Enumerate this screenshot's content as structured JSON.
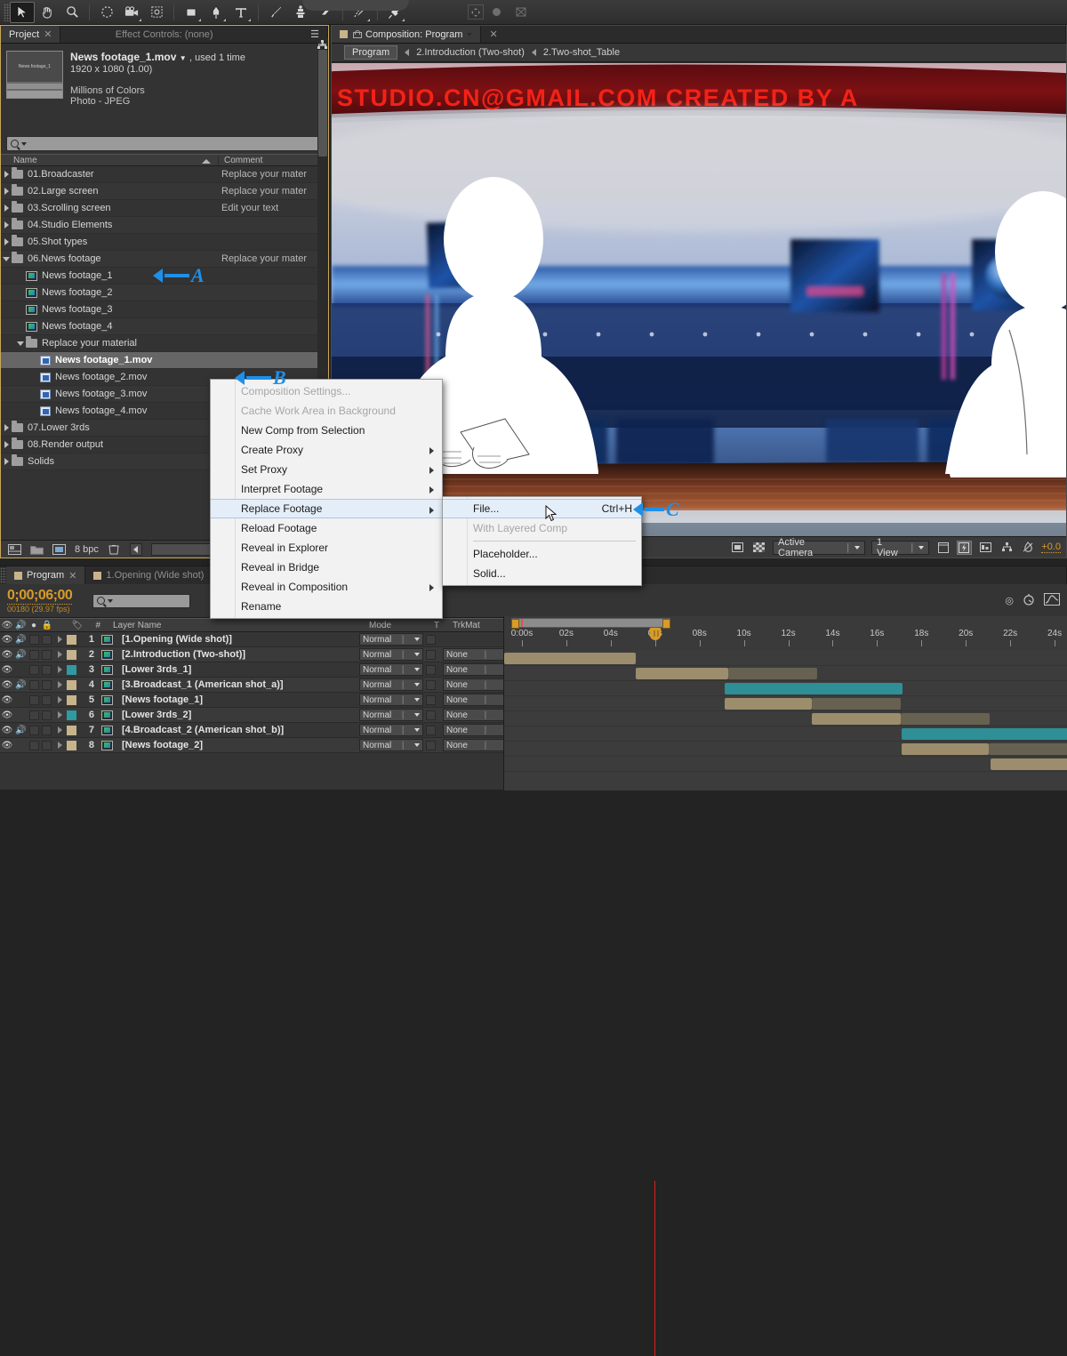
{
  "toolbar": {
    "tools": [
      {
        "name": "selection-tool",
        "glyph": "➤",
        "active": true
      },
      {
        "name": "hand-tool",
        "glyph": "✋",
        "active": false
      },
      {
        "name": "zoom-tool",
        "glyph": "⚲",
        "active": false
      },
      {
        "name": "rotation-tool",
        "glyph": "◌",
        "active": false
      },
      {
        "name": "camera-tool",
        "glyph": "🎥",
        "active": false
      },
      {
        "name": "pan-behind-tool",
        "glyph": "⬚",
        "active": false
      },
      {
        "name": "shape-tool",
        "glyph": "■",
        "active": false
      },
      {
        "name": "pen-tool",
        "glyph": "✒",
        "active": false
      },
      {
        "name": "type-tool",
        "glyph": "T",
        "active": false
      },
      {
        "name": "brush-tool",
        "glyph": "╱",
        "active": false
      },
      {
        "name": "clone-stamp-tool",
        "glyph": "⚒",
        "active": false
      },
      {
        "name": "eraser-tool",
        "glyph": "▱",
        "active": false
      },
      {
        "name": "roto-brush-tool",
        "glyph": "✒",
        "active": false
      },
      {
        "name": "puppet-pin-tool",
        "glyph": "📌",
        "active": false
      }
    ],
    "right_tools": [
      "anchor-icon",
      "dot-icon",
      "snapping-icon"
    ]
  },
  "project": {
    "tabs": [
      {
        "label": "Project",
        "selected": true,
        "closable": true
      },
      {
        "label": "Effect Controls: (none)",
        "selected": false,
        "closable": false
      }
    ],
    "menu_icon": "panel-menu-icon",
    "selected_item": {
      "thumb_label": "News footage_1",
      "name": "News footage_1.mov",
      "used": ", used 1 time",
      "dimensions": "1920 x 1080 (1.00)",
      "colors": "Millions of Colors",
      "codec": "Photo - JPEG"
    },
    "search_placeholder": "",
    "columns": {
      "name": "Name",
      "comment": "Comment"
    },
    "items": [
      {
        "label": "01.Broadcaster",
        "type": "folder",
        "indent": 0,
        "twirl": "closed",
        "comment": "Replace your mater",
        "selected": false
      },
      {
        "label": "02.Large screen",
        "type": "folder",
        "indent": 0,
        "twirl": "closed",
        "comment": "Replace your mater",
        "selected": false
      },
      {
        "label": "03.Scrolling screen",
        "type": "folder",
        "indent": 0,
        "twirl": "closed",
        "comment": "Edit your text",
        "selected": false
      },
      {
        "label": "04.Studio Elements",
        "type": "folder",
        "indent": 0,
        "twirl": "closed",
        "comment": "",
        "selected": false
      },
      {
        "label": "05.Shot types",
        "type": "folder",
        "indent": 0,
        "twirl": "closed",
        "comment": "",
        "selected": false
      },
      {
        "label": "06.News footage",
        "type": "folder",
        "indent": 0,
        "twirl": "open",
        "comment": "Replace your mater",
        "selected": false,
        "annotation": "A"
      },
      {
        "label": "News footage_1",
        "type": "comp",
        "indent": 1,
        "twirl": "none",
        "comment": "",
        "selected": false
      },
      {
        "label": "News footage_2",
        "type": "comp",
        "indent": 1,
        "twirl": "none",
        "comment": "",
        "selected": false
      },
      {
        "label": "News footage_3",
        "type": "comp",
        "indent": 1,
        "twirl": "none",
        "comment": "",
        "selected": false
      },
      {
        "label": "News footage_4",
        "type": "comp",
        "indent": 1,
        "twirl": "none",
        "comment": "",
        "selected": false
      },
      {
        "label": "Replace your material",
        "type": "folder",
        "indent": 1,
        "twirl": "open",
        "comment": "",
        "selected": false
      },
      {
        "label": "News footage_1.mov",
        "type": "mov",
        "indent": 2,
        "twirl": "none",
        "comment": "",
        "selected": true,
        "annotation": "B"
      },
      {
        "label": "News footage_2.mov",
        "type": "mov",
        "indent": 2,
        "twirl": "none",
        "comment": "",
        "selected": false
      },
      {
        "label": "News footage_3.mov",
        "type": "mov",
        "indent": 2,
        "twirl": "none",
        "comment": "",
        "selected": false
      },
      {
        "label": "News footage_4.mov",
        "type": "mov",
        "indent": 2,
        "twirl": "none",
        "comment": "",
        "selected": false
      },
      {
        "label": "07.Lower 3rds",
        "type": "folder",
        "indent": 0,
        "twirl": "closed",
        "comment": "",
        "selected": false
      },
      {
        "label": "08.Render output",
        "type": "folder",
        "indent": 0,
        "twirl": "closed",
        "comment": "",
        "selected": false
      },
      {
        "label": "Solids",
        "type": "folder",
        "indent": 0,
        "twirl": "closed",
        "comment": "",
        "selected": false
      }
    ],
    "footer": {
      "bpc": "8 bpc",
      "icons": [
        "new-comp-icon",
        "new-folder-icon",
        "interpret-footage-icon",
        "delete-icon"
      ]
    }
  },
  "composition": {
    "tabs": [
      {
        "label": "Composition: Program",
        "selected": true,
        "closable": true
      }
    ],
    "breadcrumb": [
      {
        "label": "Program",
        "chip": true
      },
      {
        "label": "2.Introduction (Two-shot)",
        "chip": false
      },
      {
        "label": "2.Two-shot_Table",
        "chip": false
      }
    ],
    "viewer": {
      "ticker_text": "STUDIO.CN@GMAIL.COM        CREATED BY A"
    },
    "footer": {
      "camera": "Active Camera",
      "views": "1 View",
      "exposure": "+0.0",
      "icons": [
        "region-of-interest-icon",
        "transparency-grid-icon",
        "title-safe-icon",
        "fast-preview-icon",
        "timeline-icon",
        "comp-flowchart-icon",
        "exposure-icon"
      ]
    }
  },
  "timeline": {
    "tabs": [
      {
        "label": "Program",
        "selected": true,
        "closable": true
      },
      {
        "label": "1.Opening (Wide shot)",
        "selected": false,
        "closable": false
      }
    ],
    "timecode": "0;00;06;00",
    "frames": "00180 (29.97 fps)",
    "search_placeholder": "",
    "columns": {
      "layer_name": "Layer Name",
      "mode": "Mode",
      "t": "T",
      "trkmat": "TrkMat",
      "hash": "#"
    },
    "header_icons": [
      "eye-icon",
      "audio-icon",
      "solo-icon",
      "lock-icon",
      "label-icon"
    ],
    "layers": [
      {
        "num": "1",
        "name": "[1.Opening (Wide shot)]",
        "mode": "Normal",
        "trkmat": "",
        "color": "#c8b48b",
        "audio": true,
        "bar_start": 0,
        "bar_len": 148,
        "tail_len": 0,
        "bar_color": "#9c8d6c"
      },
      {
        "num": "2",
        "name": "[2.Introduction (Two-shot)]",
        "mode": "Normal",
        "trkmat": "None",
        "color": "#c8b48b",
        "audio": true,
        "bar_start": 148,
        "bar_len": 104,
        "tail_len": 100,
        "bar_color": "#9c8d6c"
      },
      {
        "num": "3",
        "name": "[Lower 3rds_1]",
        "mode": "Normal",
        "trkmat": "None",
        "color": "#2f9aa0",
        "audio": false,
        "bar_start": 248,
        "bar_len": 200,
        "tail_len": 0,
        "bar_color": "#2f8f96"
      },
      {
        "num": "4",
        "name": "[3.Broadcast_1 (American shot_a)]",
        "mode": "Normal",
        "trkmat": "None",
        "color": "#c8b48b",
        "audio": true,
        "bar_start": 248,
        "bar_len": 98,
        "tail_len": 100,
        "bar_color": "#9c8d6c"
      },
      {
        "num": "5",
        "name": "[News footage_1]",
        "mode": "Normal",
        "trkmat": "None",
        "color": "#c8b48b",
        "audio": false,
        "bar_start": 346,
        "bar_len": 100,
        "tail_len": 100,
        "bar_color": "#9c8d6c"
      },
      {
        "num": "6",
        "name": "[Lower 3rds_2]",
        "mode": "Normal",
        "trkmat": "None",
        "color": "#2f9aa0",
        "audio": false,
        "bar_start": 447,
        "bar_len": 200,
        "tail_len": 0,
        "bar_color": "#2f8f96"
      },
      {
        "num": "7",
        "name": "[4.Broadcast_2 (American shot_b)]",
        "mode": "Normal",
        "trkmat": "None",
        "color": "#c8b48b",
        "audio": true,
        "bar_start": 447,
        "bar_len": 98,
        "tail_len": 100,
        "bar_color": "#9c8d6c"
      },
      {
        "num": "8",
        "name": "[News footage_2]",
        "mode": "Normal",
        "trkmat": "None",
        "color": "#c8b48b",
        "audio": false,
        "bar_start": 547,
        "bar_len": 100,
        "tail_len": 60,
        "bar_color": "#9c8d6c"
      }
    ],
    "ruler_labels": [
      "0:00s",
      "02s",
      "04s",
      "06s",
      "08s",
      "10s",
      "12s",
      "14s",
      "16s",
      "18s",
      "20s",
      "22s",
      "24s"
    ]
  },
  "context_menu": {
    "items": [
      {
        "label": "Composition Settings...",
        "disabled": true,
        "submenu": false,
        "highlight": false
      },
      {
        "label": "Cache Work Area in Background",
        "disabled": true,
        "submenu": false,
        "highlight": false
      },
      {
        "label": "New Comp from Selection",
        "disabled": false,
        "submenu": false,
        "highlight": false
      },
      {
        "label": "Create Proxy",
        "disabled": false,
        "submenu": true,
        "highlight": false
      },
      {
        "label": "Set Proxy",
        "disabled": false,
        "submenu": true,
        "highlight": false
      },
      {
        "label": "Interpret Footage",
        "disabled": false,
        "submenu": true,
        "highlight": false
      },
      {
        "label": "Replace Footage",
        "disabled": false,
        "submenu": true,
        "highlight": true
      },
      {
        "label": "Reload Footage",
        "disabled": false,
        "submenu": false,
        "highlight": false
      },
      {
        "label": "Reveal in Explorer",
        "disabled": false,
        "submenu": false,
        "highlight": false
      },
      {
        "label": "Reveal in Bridge",
        "disabled": false,
        "submenu": false,
        "highlight": false
      },
      {
        "label": "Reveal in Composition",
        "disabled": false,
        "submenu": true,
        "highlight": false
      },
      {
        "label": "Rename",
        "disabled": false,
        "submenu": false,
        "highlight": false
      }
    ]
  },
  "submenu": {
    "items": [
      {
        "label": "File...",
        "shortcut": "Ctrl+H",
        "disabled": false,
        "highlight": true,
        "separator_after": false,
        "annotation": "C"
      },
      {
        "label": "With Layered Comp",
        "shortcut": "",
        "disabled": true,
        "highlight": false,
        "separator_after": true
      },
      {
        "label": "Placeholder...",
        "shortcut": "",
        "disabled": false,
        "highlight": false,
        "separator_after": false
      },
      {
        "label": "Solid...",
        "shortcut": "",
        "disabled": false,
        "highlight": false,
        "separator_after": false
      }
    ]
  },
  "annotations": [
    {
      "letter": "A",
      "target": "06.News footage folder row"
    },
    {
      "letter": "B",
      "target": "News footage_1.mov selected row"
    },
    {
      "letter": "C",
      "target": "Replace Footage > File... menu item"
    }
  ],
  "colors": {
    "accent_orange": "#d79b2a",
    "annotation_blue": "#1e90e8",
    "panel_bg": "#333333",
    "comp_label": "#c8b48b",
    "teal_label": "#2f9aa0",
    "playhead_red": "#e02020"
  }
}
